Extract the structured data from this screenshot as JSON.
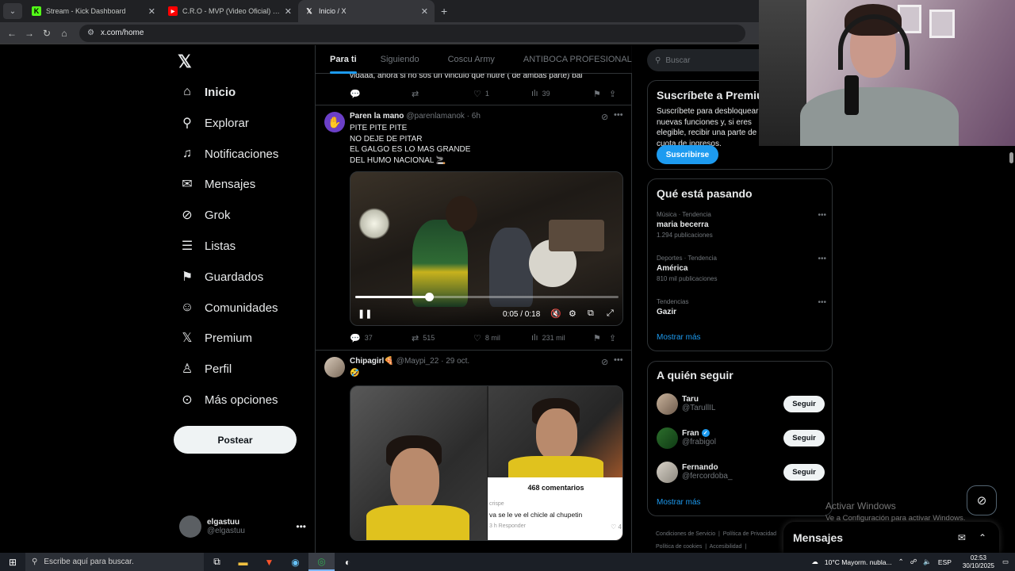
{
  "browser": {
    "tabs": [
      {
        "title": "Stream - Kick Dashboard",
        "favicon": "kick-icon",
        "color": "#53fc18"
      },
      {
        "title": "C.R.O - MVP (Video Oficial) - YouTube",
        "favicon": "youtube-icon",
        "color": "#ff0000"
      },
      {
        "title": "Inicio / X",
        "favicon": "x-icon",
        "color": "#ffffff"
      }
    ],
    "new_tab": "+",
    "url": "x.com/home"
  },
  "nav": {
    "logo": "X",
    "items": [
      {
        "label": "Inicio",
        "icon": "home-icon"
      },
      {
        "label": "Explorar",
        "icon": "search-icon"
      },
      {
        "label": "Notificaciones",
        "icon": "bell-icon"
      },
      {
        "label": "Mensajes",
        "icon": "envelope-icon"
      },
      {
        "label": "Grok",
        "icon": "grok-icon"
      },
      {
        "label": "Listas",
        "icon": "list-icon"
      },
      {
        "label": "Guardados",
        "icon": "bookmark-icon"
      },
      {
        "label": "Comunidades",
        "icon": "people-icon"
      },
      {
        "label": "Premium",
        "icon": "x-icon"
      },
      {
        "label": "Perfil",
        "icon": "person-icon"
      },
      {
        "label": "Más opciones",
        "icon": "more-circle-icon"
      }
    ],
    "post_button": "Postear",
    "account": {
      "name": "elgastuu",
      "handle": "@elgastuu",
      "more": "•••"
    }
  },
  "timeline": {
    "tabs": [
      "Para ti",
      "Siguiendo",
      "Coscu Army",
      "ANTIBOCA PROFESIONAL"
    ],
    "prev_tweet_text": "vidaaa, ahora si no sos un vinculo que nutre ( de ambas parte) bai",
    "prev_actions": {
      "replies": "",
      "retweets": "",
      "likes": "1",
      "views": "39"
    },
    "tweet1": {
      "name": "Paren la mano",
      "handle": "@parenlamanok · 6h",
      "text": "PITE PITE PITE\nNO DEJE DE PITAR\nEL GALGO ES LO MAS GRANDE\nDEL HUMO NACIONAL 🚬",
      "video": {
        "time": "0:05 / 0:18",
        "progress": 0.28
      },
      "actions": {
        "replies": "37",
        "retweets": "515",
        "likes": "8 mil",
        "views": "231 mil"
      }
    },
    "tweet2": {
      "name": "Chipagirl🍕",
      "handle": "@Maypi_22 · 29 oct.",
      "text": "🤣",
      "comments_header": "468 comentarios",
      "comment_user": "crispe",
      "comment_text": "va se le ve el chicle al chupetin",
      "comment_meta": "3 h     Responder",
      "likes_small": "4"
    }
  },
  "right": {
    "search_placeholder": "Buscar",
    "premium": {
      "title": "Suscríbete a Premium",
      "text": "Suscríbete para desbloquear nuevas funciones y, si eres elegible, recibir una parte de cuota de ingresos.",
      "button": "Suscribirse"
    },
    "trends": {
      "title": "Qué está pasando",
      "items": [
        {
          "category": "Música · Tendencia",
          "name": "maria becerra",
          "posts": "1.294 publicaciones"
        },
        {
          "category": "Deportes · Tendencia",
          "name": "América",
          "posts": "810 mil publicaciones"
        },
        {
          "category": "Tendencias",
          "name": "Gazir",
          "posts": ""
        }
      ],
      "show_more": "Mostrar más"
    },
    "follow": {
      "title": "A quién seguir",
      "users": [
        {
          "name": "Taru",
          "handle": "@TarullIL",
          "verified": false
        },
        {
          "name": "Fran",
          "handle": "@frabigol",
          "verified": true
        },
        {
          "name": "Fernando",
          "handle": "@fercordoba_",
          "verified": false
        }
      ],
      "button": "Seguir",
      "show_more": "Mostrar más"
    },
    "footer": [
      "Condiciones de Servicio",
      "Política de Privacidad",
      "Política de cookies",
      "Accesibilidad"
    ],
    "messages": "Mensajes",
    "watermark": {
      "line1": "Activar Windows",
      "line2": "Ve a Configuración para activar Windows."
    }
  },
  "taskbar": {
    "search": "Escribe aquí para buscar.",
    "weather": "10°C  Mayorm. nubla...",
    "lang": "ESP",
    "time": "02:53",
    "date": "30/10/2025"
  }
}
